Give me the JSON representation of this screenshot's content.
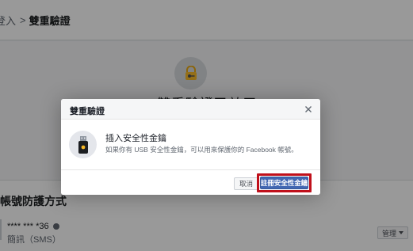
{
  "breadcrumb": {
    "previous": "登入",
    "separator": ">",
    "current": "雙重驗證"
  },
  "hero": {
    "title": "雙重驗證已啟用"
  },
  "protection": {
    "section_title": "帳號防護方式",
    "phone_masked": "**** *** *36",
    "phone_method": "簡訊（SMS）",
    "manage_label": "管理"
  },
  "dialog": {
    "title": "雙重驗證",
    "heading": "插入安全性金鑰",
    "description": "如果你有 USB 安全性金鑰，可以用來保護你的 Facebook 帳號。",
    "cancel_label": "取消",
    "register_label": "註冊安全性金鑰"
  },
  "colors": {
    "primary": "#4267b2",
    "highlight_border": "#c0101b",
    "key_yellow": "#f7b928"
  },
  "icons": {
    "hero": "lock-key-icon",
    "dialog": "usb-key-icon",
    "close": "close-icon",
    "info": "info-icon",
    "dropdown": "caret-down-icon"
  }
}
